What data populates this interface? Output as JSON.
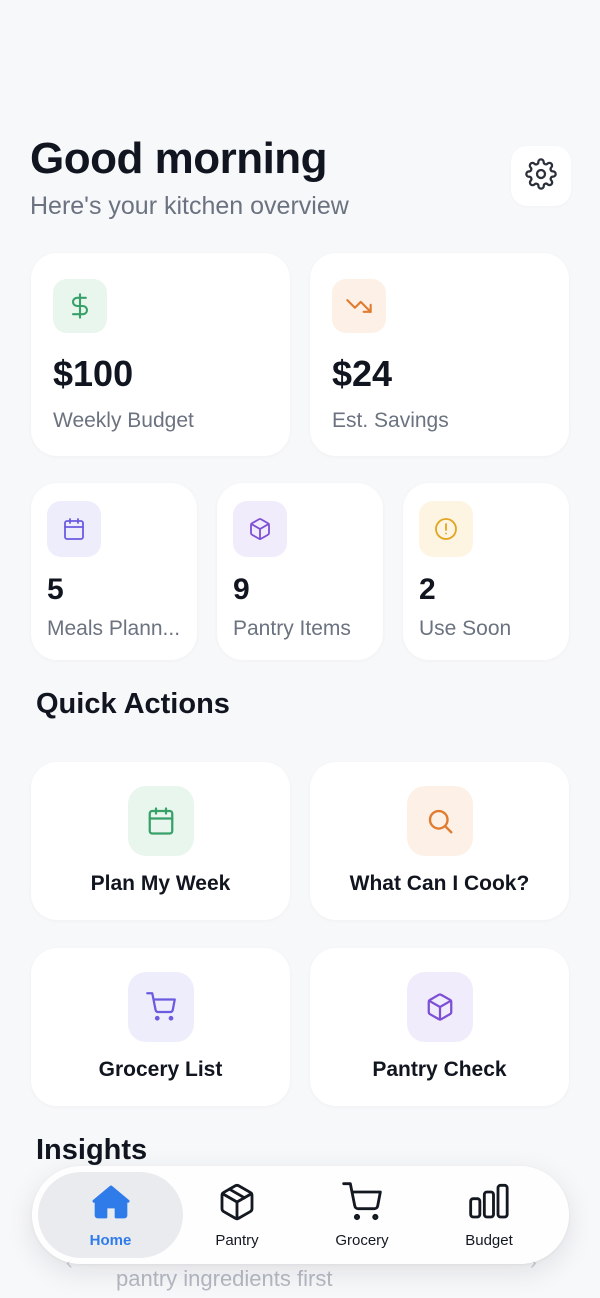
{
  "header": {
    "greeting": "Good morning",
    "subtitle": "Here's your kitchen overview",
    "settings_icon": "gear-icon"
  },
  "stats_primary": [
    {
      "value": "$100",
      "label": "Weekly Budget",
      "icon": "dollar-icon",
      "color": "#38a169"
    },
    {
      "value": "$24",
      "label": "Est. Savings",
      "icon": "trending-down-icon",
      "color": "#e07b30"
    }
  ],
  "stats_secondary": [
    {
      "value": "5",
      "label": "Meals Plann...",
      "icon": "calendar-icon",
      "color": "#6b5be0"
    },
    {
      "value": "9",
      "label": "Pantry Items",
      "icon": "box-icon",
      "color": "#7c4fd4"
    },
    {
      "value": "2",
      "label": "Use Soon",
      "icon": "alert-circle-icon",
      "color": "#e3a420"
    }
  ],
  "quick_actions": {
    "title": "Quick Actions",
    "items": [
      {
        "label": "Plan My Week",
        "icon": "calendar-icon"
      },
      {
        "label": "What Can I Cook?",
        "icon": "search-icon"
      },
      {
        "label": "Grocery List",
        "icon": "cart-icon"
      },
      {
        "label": "Pantry Check",
        "icon": "box-icon"
      }
    ]
  },
  "insights": {
    "title": "Insights",
    "peek_text": "pantry ingredients first"
  },
  "tabbar": {
    "active": "Home",
    "tabs": [
      {
        "label": "Home",
        "icon": "home-icon"
      },
      {
        "label": "Pantry",
        "icon": "box-icon"
      },
      {
        "label": "Grocery",
        "icon": "cart-icon"
      },
      {
        "label": "Budget",
        "icon": "bar-chart-icon"
      }
    ]
  },
  "colors": {
    "accent": "#2f7bea",
    "background": "#f7f8fa"
  }
}
